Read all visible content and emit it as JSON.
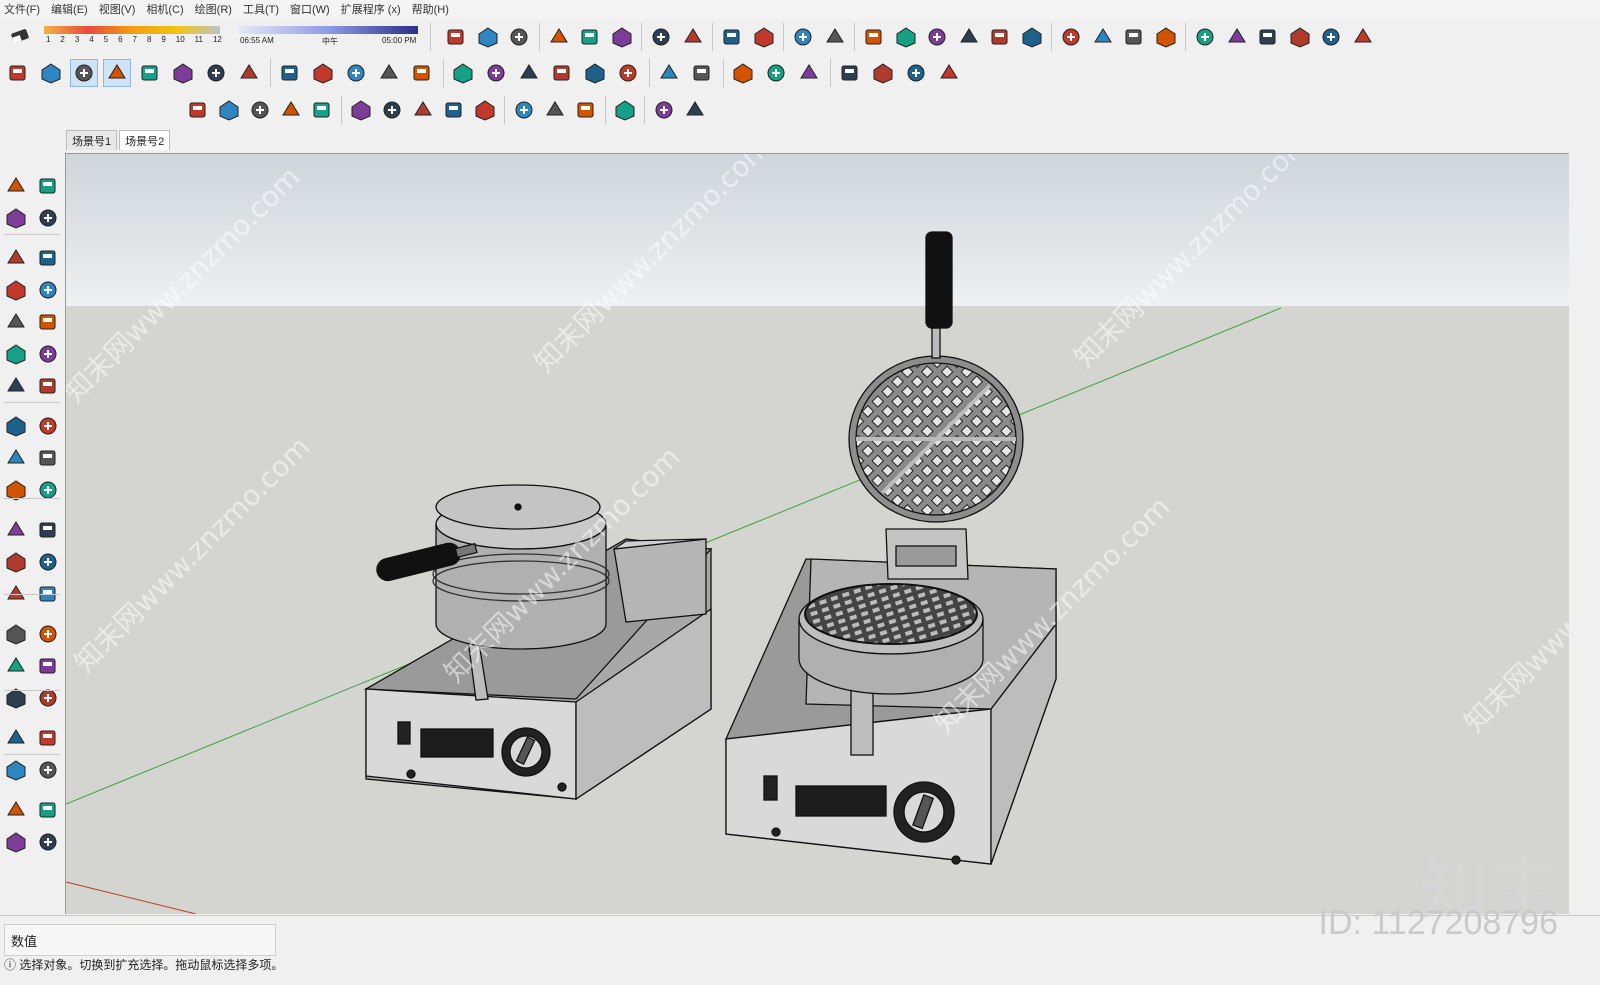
{
  "menu": [
    "文件(F)",
    "编辑(E)",
    "视图(V)",
    "相机(C)",
    "绘图(R)",
    "工具(T)",
    "窗口(W)",
    "扩展程序 (x)",
    "帮助(H)"
  ],
  "shadow": {
    "months": [
      "1",
      "2",
      "3",
      "4",
      "5",
      "6",
      "7",
      "8",
      "9",
      "10",
      "11",
      "12"
    ],
    "time_start": "06:55 AM",
    "time_mid": "中午",
    "time_end": "05:00 PM"
  },
  "scene_tabs": [
    "场景号1",
    "场景号2"
  ],
  "active_scene_tab": 1,
  "status": {
    "vcb_label": "数值",
    "hint": "选择对象。切换到扩充选择。拖动鼠标选择多项。"
  },
  "watermark": {
    "brand": "知末",
    "id": "ID: 1127208796",
    "site": "知末网www.znzmo.com"
  },
  "toolbar_icons": {
    "row1": [
      "eraser-icon",
      "new-file-icon",
      "open-folder-icon",
      "save-icon",
      "cut-icon",
      "copy-icon",
      "paste-icon",
      "delete-icon",
      "undo-icon",
      "redo-icon",
      "print-icon",
      "model-info-icon",
      "components-icon",
      "section-plane-icon",
      "section-display-icon",
      "section-cut-icon",
      "section-fill-icon",
      "section-face-icon",
      "layout-icon",
      "style-builder-icon",
      "warehouse-icon",
      "extension-warehouse-icon",
      "camera-icon",
      "film-reel-icon",
      "animation-icon",
      "tour-icon",
      "flag-icon",
      "send-icon",
      "no-entry-icon"
    ],
    "row2": [
      "orbit-center-icon",
      "iso-view-icon",
      "top-view-icon",
      "front-view-icon",
      "right-view-icon",
      "back-view-icon",
      "left-view-icon",
      "house-icon",
      "bottom-view-icon",
      "xray-icon",
      "wireframe-icon",
      "hidden-line-icon",
      "shaded-icon",
      "textured-icon",
      "monochrome-icon",
      "display-edges-icon",
      "profiles-icon",
      "depth-cue-icon",
      "extension-lines-icon",
      "globe-icon",
      "sandbox-icon",
      "from-contours-icon",
      "from-scratch-icon",
      "smoove-icon",
      "stamp-icon",
      "drape-icon",
      "add-detail-icon",
      "flip-edge-icon"
    ],
    "row3": [
      "component-icon",
      "check-icon",
      "upload-icon",
      "link-icon",
      "trimble-icon",
      "solid-tools-icon",
      "refresh-icon",
      "advanced-camera-icon",
      "camera-tool-icon",
      "photo-icon",
      "settings-icon",
      "dynamic-icon",
      "sound-icon",
      "preferences-icon",
      "chat-icon",
      "info-icon"
    ]
  },
  "left_tools": [
    "select-icon",
    "make-component-icon",
    "paint-bucket-icon",
    "eraser-tool-icon",
    "pencil-icon",
    "freehand-icon",
    "rectangle-icon",
    "rotated-rectangle-icon",
    "circle-icon",
    "polygon-icon",
    "arc-icon",
    "pie-icon",
    "two-point-arc-icon",
    "three-point-arc-icon",
    "move-icon",
    "push-pull-icon",
    "rotate-icon",
    "follow-me-icon",
    "scale-icon",
    "offset-icon",
    "tape-measure-icon",
    "dimension-icon",
    "protractor-icon",
    "text-icon",
    "axes-icon",
    "3d-text-icon",
    "orbit-icon",
    "pan-icon",
    "zoom-icon",
    "zoom-window-icon",
    "zoom-extents-icon",
    "previous-view-icon",
    "position-camera-icon",
    "look-around-icon",
    "walk-icon",
    "section-tool-icon",
    "ruby-console-icon",
    "sketchup-ruby-icon",
    "layout-send-icon",
    "ruby-gem-icon"
  ]
}
